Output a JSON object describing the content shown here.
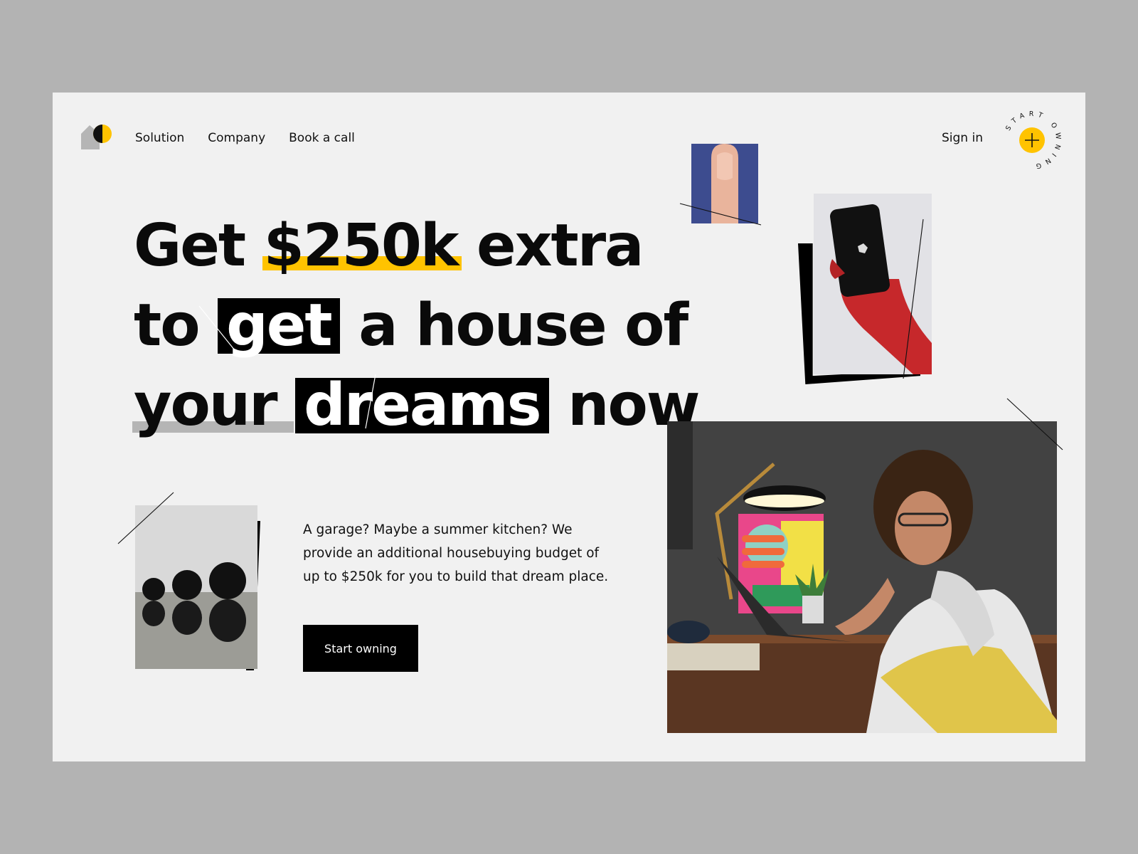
{
  "nav": {
    "items": [
      {
        "label": "Solution"
      },
      {
        "label": "Company"
      },
      {
        "label": "Book a call"
      }
    ],
    "signin": "Sign in",
    "badge_text": "START OWNING",
    "badge_icon": "plus-icon"
  },
  "headline": {
    "line1_a": "Get",
    "line1_amount": "$250k",
    "line1_b": "extra",
    "line2_a": "to",
    "line2_get": "get",
    "line2_b": "a house of",
    "line3_your": "your",
    "line3_dreams": "dreams",
    "line3_b": "now"
  },
  "description": "A garage? Maybe a summer kitchen? We provide an additional housebuying budget of up to $250k for you to build that dream place.",
  "cta": {
    "label": "Start owning"
  },
  "colors": {
    "accent": "#ffc300",
    "background": "#f1f1f1",
    "frame": "#b3b3b3",
    "dark": "#000000"
  }
}
